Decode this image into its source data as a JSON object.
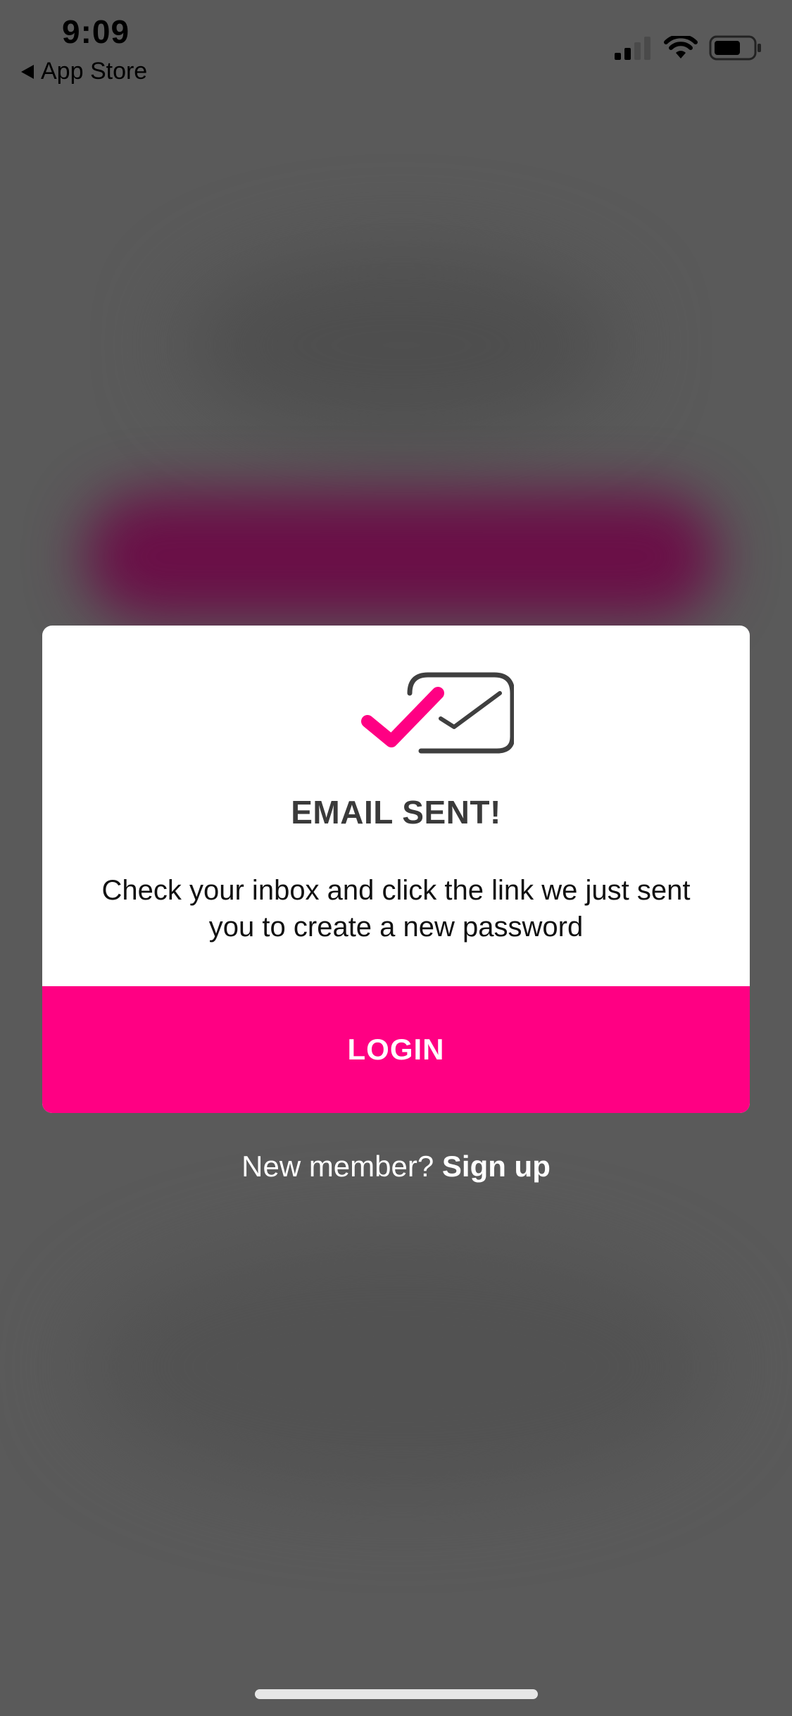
{
  "status_bar": {
    "time": "9:09",
    "back_label": "App Store",
    "icons": [
      "signal-icon",
      "wifi-icon",
      "battery-icon"
    ]
  },
  "modal": {
    "icon": "email-sent-check-icon",
    "title": "EMAIL SENT!",
    "message": "Check your inbox and click the link we just sent you to create a new password",
    "login_label": "LOGIN"
  },
  "signup": {
    "prompt": "New member?",
    "link_label": "Sign up"
  },
  "colors": {
    "accent": "#ff0083",
    "overlay": "#5a5a5a",
    "title": "#3a3a3a",
    "blurred_button": "#6a0f47"
  }
}
